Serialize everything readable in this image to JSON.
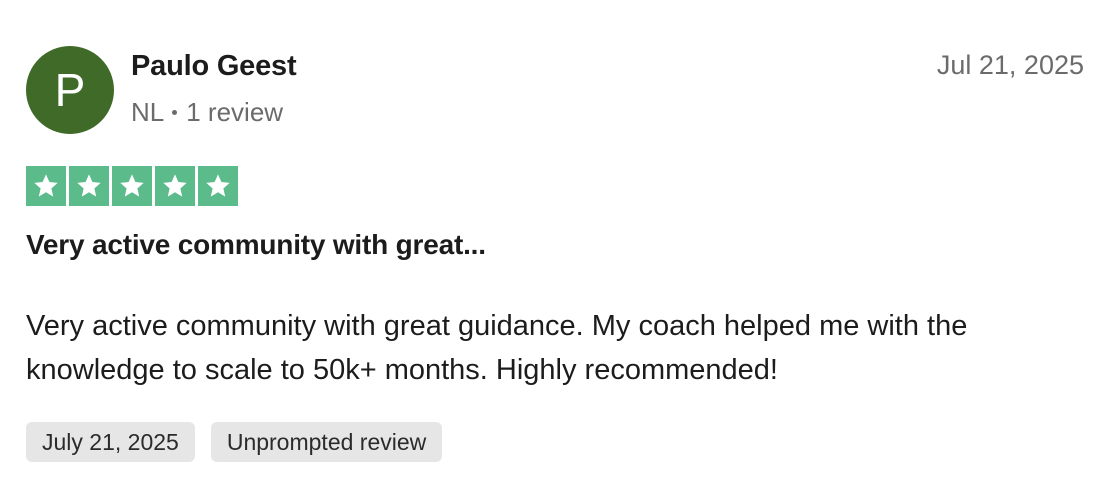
{
  "reviewer": {
    "avatar_initial": "P",
    "avatar_color": "#3f6a28",
    "name": "Paulo Geest",
    "country": "NL",
    "review_count": "1 review"
  },
  "review": {
    "date": "Jul 21, 2025",
    "rating": 5,
    "rating_max": 5,
    "star_color": "#5cbb8a",
    "title": "Very active community with great...",
    "body": "Very active community with great guidance. My coach helped me with the knowledge to scale to 50k+ months. Highly recommended!",
    "tags": [
      "July 21, 2025",
      "Unprompted review"
    ]
  }
}
